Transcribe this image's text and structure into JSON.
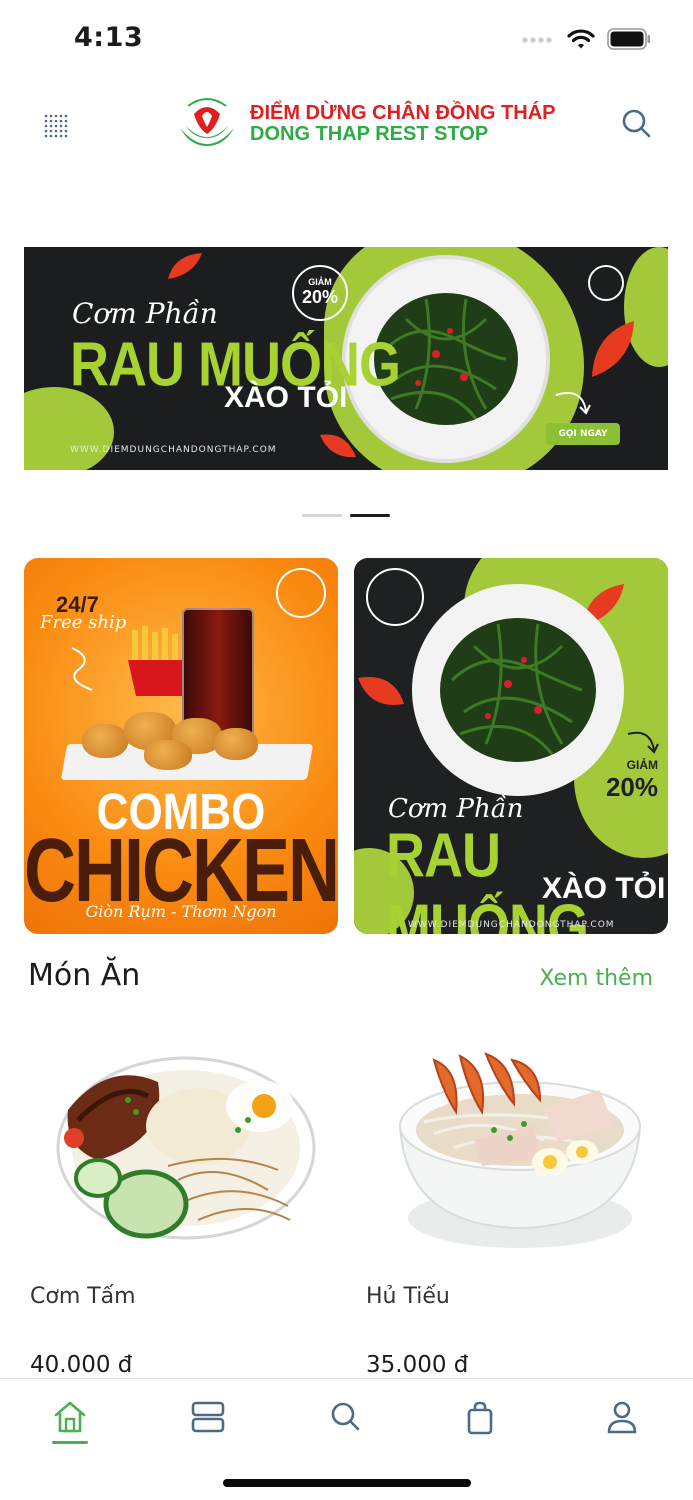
{
  "status_bar": {
    "time": "4:13",
    "icons": [
      "signal-icon",
      "wifi-icon",
      "battery-icon"
    ]
  },
  "header": {
    "logo_line1": "ĐIỂM DỪNG CHÂN ĐỒNG THÁP",
    "logo_line2": "DONG THAP REST STOP",
    "logo_mark_text": "Điểm Dừng Chân ĐỒNG THÁP",
    "brand_colors": {
      "red": "#e02020",
      "green": "#2eab45"
    }
  },
  "banner": {
    "script": "Cơm Phần",
    "headline": "RAU MUỐNG",
    "sub": "XÀO TỎI",
    "discount_label": "GIẢM",
    "discount_value": "20%",
    "cta": "GỌI NGAY",
    "url": "WWW.DIEMDUNGCHANDONGTHAP.COM",
    "slides": 2,
    "active_slide": 2
  },
  "promos": {
    "chicken": {
      "line1": "24/7",
      "line2": "Free ship",
      "combo": "COMBO",
      "chicken": "CHICKEN",
      "tagline": "Giòn Rụm - Thơm Ngon"
    },
    "rau": {
      "script": "Cơm Phần",
      "headline": "RAU MUỐNG",
      "sub": "XÀO TỎI",
      "discount_label": "GIẢM",
      "discount_value": "20%",
      "url": "WWW.DIEMDUNGCHANDONGTHAP.COM"
    }
  },
  "section": {
    "title": "Món Ăn",
    "more": "Xem thêm"
  },
  "products": [
    {
      "name": "Cơm Tấm",
      "price": "40.000 đ"
    },
    {
      "name": "Hủ Tiếu",
      "price": "35.000 đ"
    }
  ],
  "bottom_nav": {
    "items": [
      "home-icon",
      "categories-icon",
      "search-icon",
      "bag-icon",
      "profile-icon"
    ],
    "active": "home-icon",
    "accent": "#4caf50"
  }
}
